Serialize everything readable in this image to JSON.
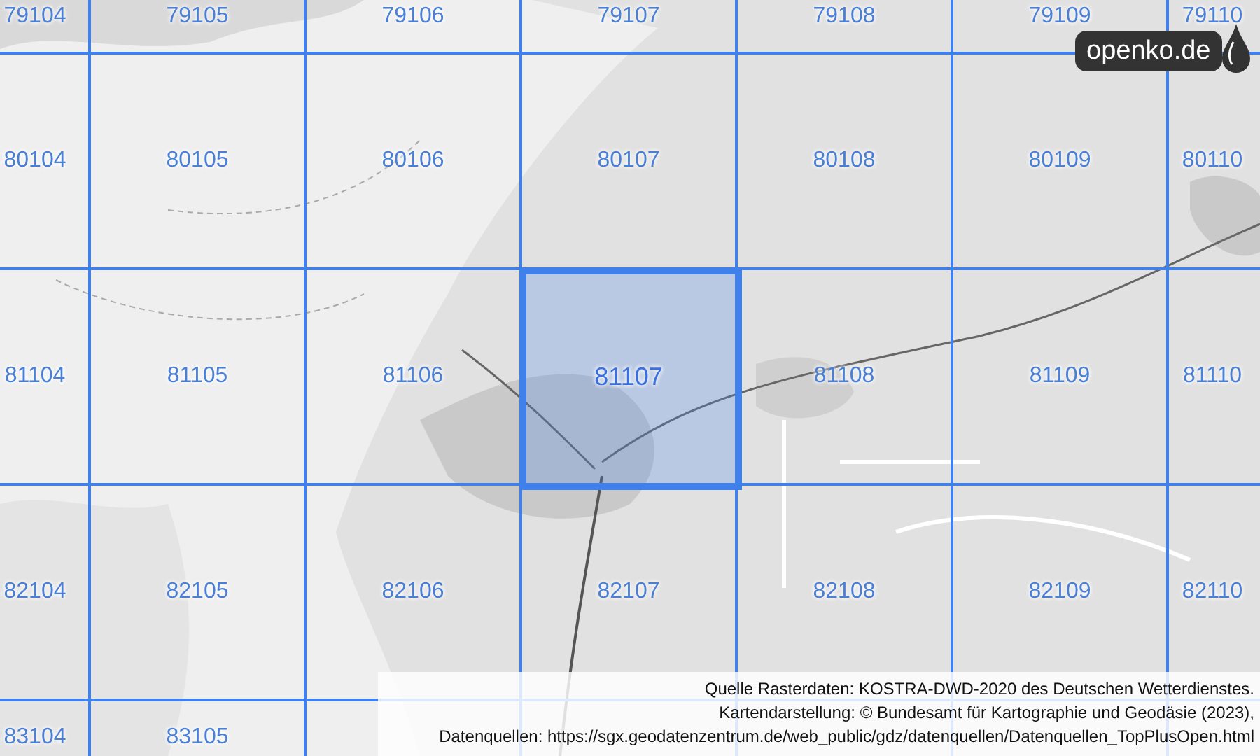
{
  "logo": "openko.de",
  "grid": {
    "rows": [
      {
        "cells": [
          {
            "label": "79104",
            "selected": false
          },
          {
            "label": "79105",
            "selected": false
          },
          {
            "label": "79106",
            "selected": false
          },
          {
            "label": "79107",
            "selected": false
          },
          {
            "label": "79108",
            "selected": false
          },
          {
            "label": "79109",
            "selected": false
          },
          {
            "label": "79110",
            "selected": false
          }
        ]
      },
      {
        "cells": [
          {
            "label": "80104",
            "selected": false
          },
          {
            "label": "80105",
            "selected": false
          },
          {
            "label": "80106",
            "selected": false
          },
          {
            "label": "80107",
            "selected": false
          },
          {
            "label": "80108",
            "selected": false
          },
          {
            "label": "80109",
            "selected": false
          },
          {
            "label": "80110",
            "selected": false
          }
        ]
      },
      {
        "cells": [
          {
            "label": "81104",
            "selected": false
          },
          {
            "label": "81105",
            "selected": false
          },
          {
            "label": "81106",
            "selected": false
          },
          {
            "label": "81107",
            "selected": true
          },
          {
            "label": "81108",
            "selected": false
          },
          {
            "label": "81109",
            "selected": false
          },
          {
            "label": "81110",
            "selected": false
          }
        ]
      },
      {
        "cells": [
          {
            "label": "82104",
            "selected": false
          },
          {
            "label": "82105",
            "selected": false
          },
          {
            "label": "82106",
            "selected": false
          },
          {
            "label": "82107",
            "selected": false
          },
          {
            "label": "82108",
            "selected": false
          },
          {
            "label": "82109",
            "selected": false
          },
          {
            "label": "82110",
            "selected": false
          }
        ]
      },
      {
        "cells": [
          {
            "label": "83104",
            "selected": false
          },
          {
            "label": "83105",
            "selected": false
          }
        ]
      }
    ]
  },
  "attribution": [
    "Quelle Rasterdaten: KOSTRA-DWD-2020 des Deutschen Wetterdienstes.",
    "Kartendarstellung: © Bundesamt für Kartographie und Geodäsie (2023),",
    "Datenquellen: https://sgx.geodatenzentrum.de/web_public/gdz/datenquellen/Datenquellen_TopPlusOpen.html"
  ]
}
